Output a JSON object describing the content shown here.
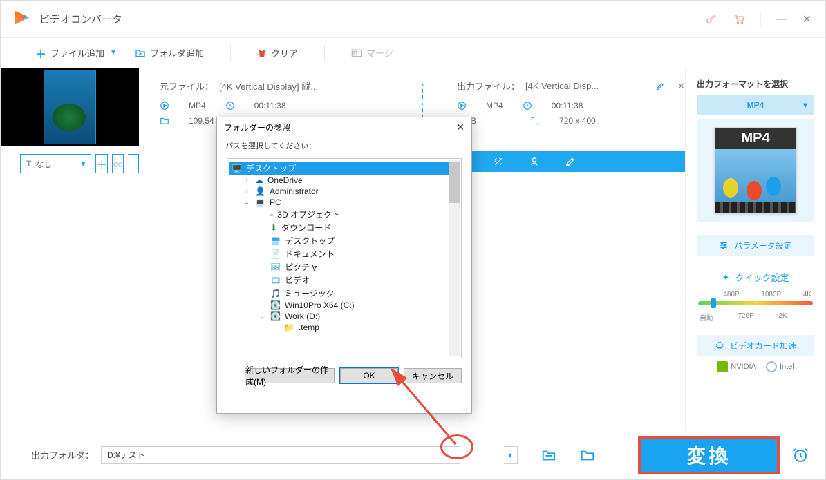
{
  "title": "ビデオコンバータ",
  "toolbar": {
    "add_file": "ファイル追加",
    "add_folder": "フォルダ追加",
    "clear": "クリア",
    "merge": "マージ"
  },
  "source": {
    "label_prefix": "元ファイル：",
    "filename": "[4K Vertical Display] 縦...",
    "format": "MP4",
    "duration": "00:11:38",
    "size": "109.54"
  },
  "output": {
    "label_prefix": "出力ファイル：",
    "filename": "[4K Vertical Disp...",
    "format": "MP4",
    "duration": "00:11:38",
    "resolution": "720 x 400",
    "size_suffix": "B"
  },
  "subtitle": {
    "none": "なし"
  },
  "right": {
    "choose_format": "出力フォーマットを選択",
    "format": "MP4",
    "card_label": "MP4",
    "param_settings": "パラメータ設定",
    "quick_settings": "クイック設定",
    "top": {
      "p480": "480P",
      "p1080": "1080P",
      "p4k": "4K"
    },
    "bottom": {
      "auto": "自動",
      "p720": "720P",
      "p2k": "2K"
    },
    "gpu_accel": "ビデオカード加速",
    "nvidia": "NVIDIA",
    "intel": "Intel"
  },
  "footer": {
    "label": "出力フォルダ：",
    "path": "D:¥テスト",
    "convert": "変換"
  },
  "modal": {
    "title": "フォルダーの参照",
    "subtitle": "パスを選択してください：",
    "items": {
      "desktop": "デスクトップ",
      "onedrive": "OneDrive",
      "admin": "Administrator",
      "pc": "PC",
      "objects3d": "3D オブジェクト",
      "downloads": "ダウンロード",
      "desktop2": "デスクトップ",
      "documents": "ドキュメント",
      "pictures": "ピクチャ",
      "videos": "ビデオ",
      "music": "ミュージック",
      "cdrive": "Win10Pro X64 (C:)",
      "ddrive": "Work (D:)",
      "temp": ".temp"
    },
    "new_folder": "新しいフォルダーの作成(M)",
    "ok": "OK",
    "cancel": "キャンセル"
  }
}
